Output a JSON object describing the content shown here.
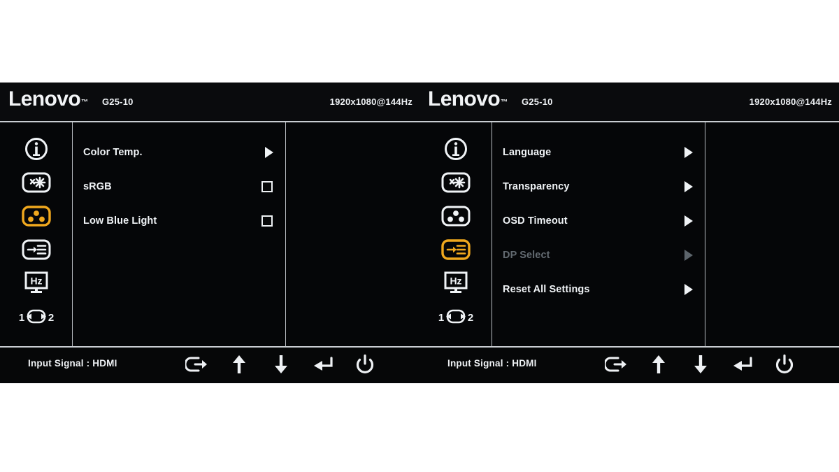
{
  "panels": [
    {
      "id": "color-settings-panel",
      "header": {
        "brand": "Lenovo",
        "brand_tm": "™",
        "model": "G25-10",
        "resolution": "1920x1080@144Hz"
      },
      "rail": [
        {
          "icon": "info-icon",
          "label": "Information",
          "active": false
        },
        {
          "icon": "brightness-contrast-icon",
          "label": "Basic Settings",
          "active": false
        },
        {
          "icon": "color-settings-icon",
          "label": "Color Settings",
          "active": true
        },
        {
          "icon": "input-select-icon",
          "label": "Menu Settings",
          "active": false
        },
        {
          "icon": "refresh-rate-icon",
          "label": "Refresh Rate",
          "active": false
        },
        {
          "icon": "input-switch-icon",
          "label": "Input Switch",
          "active": false
        }
      ],
      "items": [
        {
          "label": "Color Temp.",
          "control": "arrow",
          "disabled": false
        },
        {
          "label": "sRGB",
          "control": "checkbox",
          "checked": false,
          "disabled": false
        },
        {
          "label": "Low Blue Light",
          "control": "checkbox",
          "checked": false,
          "disabled": false
        }
      ],
      "footer": {
        "input_signal": "Input Signal : HDMI",
        "buttons": [
          {
            "icon": "exit-icon",
            "label": "Exit"
          },
          {
            "icon": "arrow-up-icon",
            "label": "Up"
          },
          {
            "icon": "arrow-down-icon",
            "label": "Down"
          },
          {
            "icon": "enter-icon",
            "label": "Enter"
          },
          {
            "icon": "power-icon",
            "label": "Power"
          }
        ]
      }
    },
    {
      "id": "menu-settings-panel",
      "header": {
        "brand": "Lenovo",
        "brand_tm": "™",
        "model": "G25-10",
        "resolution": "1920x1080@144Hz"
      },
      "rail": [
        {
          "icon": "info-icon",
          "label": "Information",
          "active": false
        },
        {
          "icon": "brightness-contrast-icon",
          "label": "Basic Settings",
          "active": false
        },
        {
          "icon": "color-settings-icon",
          "label": "Color Settings",
          "active": false
        },
        {
          "icon": "input-select-icon",
          "label": "Menu Settings",
          "active": true
        },
        {
          "icon": "refresh-rate-icon",
          "label": "Refresh Rate",
          "active": false
        },
        {
          "icon": "input-switch-icon",
          "label": "Input Switch",
          "active": false
        }
      ],
      "items": [
        {
          "label": "Language",
          "control": "arrow",
          "disabled": false
        },
        {
          "label": "Transparency",
          "control": "arrow",
          "disabled": false
        },
        {
          "label": "OSD Timeout",
          "control": "arrow",
          "disabled": false
        },
        {
          "label": "DP Select",
          "control": "arrow",
          "disabled": true
        },
        {
          "label": "Reset All Settings",
          "control": "arrow",
          "disabled": false
        }
      ],
      "footer": {
        "input_signal": "Input Signal : HDMI",
        "buttons": [
          {
            "icon": "exit-icon",
            "label": "Exit"
          },
          {
            "icon": "arrow-up-icon",
            "label": "Up"
          },
          {
            "icon": "arrow-down-icon",
            "label": "Down"
          },
          {
            "icon": "enter-icon",
            "label": "Enter"
          },
          {
            "icon": "power-icon",
            "label": "Power"
          }
        ]
      }
    }
  ],
  "colors": {
    "accent": "#f0a81e",
    "text": "#f0f3f6",
    "text_disabled": "#636a71",
    "panel_bg": "#050608",
    "divider": "#b9bdc2",
    "page_bg": "#ffffff"
  }
}
